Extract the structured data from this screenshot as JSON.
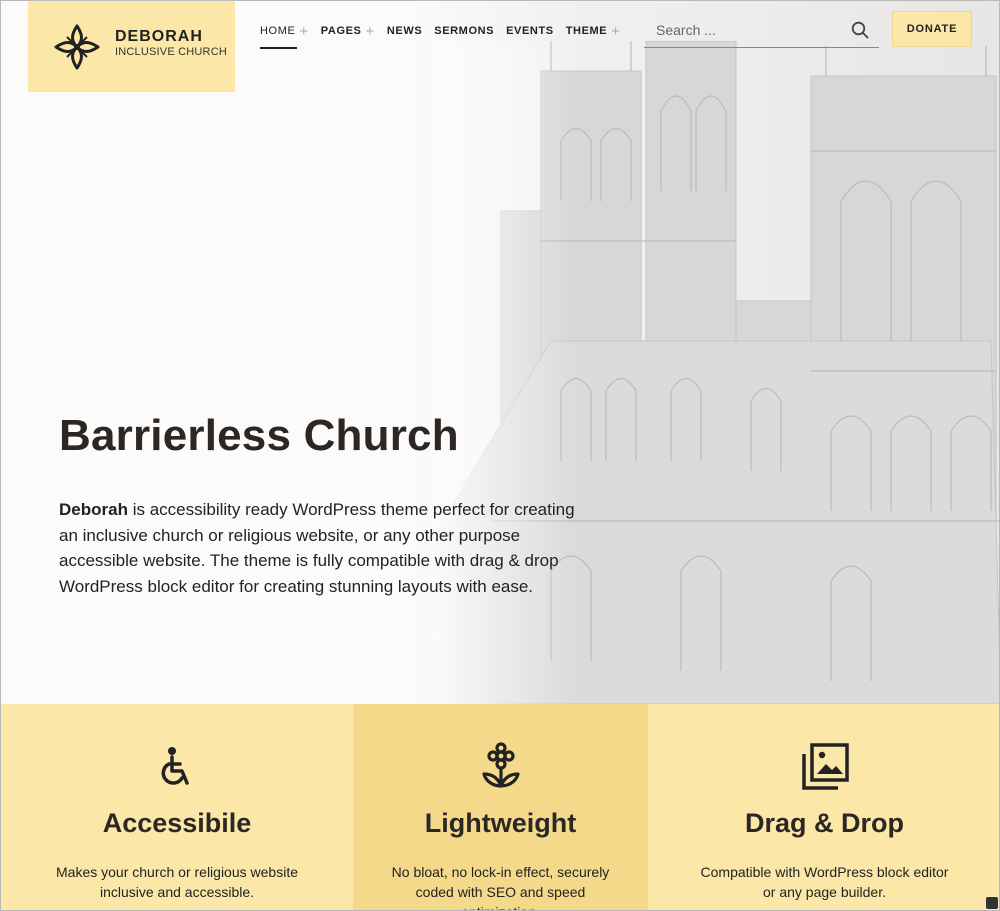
{
  "header": {
    "logo": {
      "title": "DEBORAH",
      "subtitle": "INCLUSIVE CHURCH",
      "icon": "flower-ornament-icon"
    },
    "nav": [
      {
        "label": "HOME",
        "active": true,
        "has_submenu": true
      },
      {
        "label": "PAGES",
        "active": false,
        "has_submenu": true
      },
      {
        "label": "NEWS",
        "active": false,
        "has_submenu": false
      },
      {
        "label": "SERMONS",
        "active": false,
        "has_submenu": false
      },
      {
        "label": "EVENTS",
        "active": false,
        "has_submenu": false
      },
      {
        "label": "THEME",
        "active": false,
        "has_submenu": true
      }
    ],
    "search": {
      "placeholder": "Search ...",
      "value": "",
      "icon": "search-icon"
    },
    "donate_label": "DONATE"
  },
  "hero": {
    "title": "Barrierless Church",
    "text_bold": "Deborah",
    "text_rest": " is accessibility ready WordPress theme perfect for creating an inclusive church or religious website, or any other purpose accessible website. The theme is fully compatible with drag & drop WordPress block editor for creating stunning layouts with ease.",
    "background_image": "cathedral-sketch"
  },
  "features": [
    {
      "icon": "accessibility-icon",
      "title": "Accessibile",
      "description": "Makes your church or religious website inclusive and accessible."
    },
    {
      "icon": "flower-icon",
      "title": "Lightweight",
      "description": "No bloat, no lock-in effect, securely coded with SEO and speed optimization."
    },
    {
      "icon": "gallery-icon",
      "title": "Drag & Drop",
      "description": "Compatible with WordPress block editor or any page builder."
    }
  ],
  "colors": {
    "accent": "#fbe7a8",
    "accent_dark": "#f4d98b",
    "text": "#222222"
  }
}
